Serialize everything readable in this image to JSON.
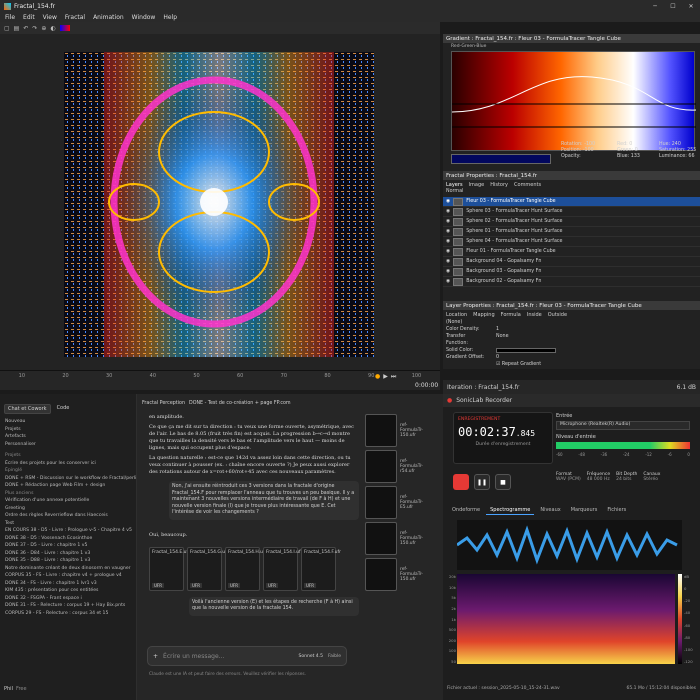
{
  "window": {
    "title": "Fractal_154.fr",
    "minimize": "─",
    "maximize": "☐",
    "close": "✕"
  },
  "menu": [
    "File",
    "Edit",
    "View",
    "Fractal",
    "Animation",
    "Window",
    "Help"
  ],
  "timeline": {
    "ticks": [
      "10",
      "20",
      "30",
      "40",
      "50",
      "60",
      "70",
      "80",
      "90",
      "100"
    ],
    "time": "0:00:00"
  },
  "gradient": {
    "title": "Gradient : Fractal_154.fr : Fleur 03 - FormulaTracer Tangle Cube",
    "preset": "Red-Green-Blue",
    "controls": [
      {
        "l": "Rotation:",
        "v": "-100"
      },
      {
        "l": "Red:",
        "v": "0"
      },
      {
        "l": "Hue:",
        "v": "240"
      },
      {
        "l": "Position:",
        "v": "-100"
      },
      {
        "l": "Green:",
        "v": "0"
      },
      {
        "l": "Saturation:",
        "v": "255"
      },
      {
        "l": "Opacity:",
        "v": ""
      },
      {
        "l": "Blue:",
        "v": "133"
      },
      {
        "l": "Luminance:",
        "v": "66"
      }
    ]
  },
  "fractal_props": {
    "title": "Fractal Properties : Fractal_154.fr",
    "tabs": [
      "Layers",
      "Image",
      "History",
      "Comments"
    ],
    "mode": "Normal",
    "layers": [
      "Fleur 03 - FormulaTracer Tangle Cube",
      "Sphere 03 - FormulaTracer Hunt Surface",
      "Sphere 02 - FormulaTracer Hunt Surface",
      "Sphere 01 - FormulaTracer Hunt Surface",
      "Sphere 04 - FormulaTracer Hunt Surface",
      "Fleur 01 - FormulaTracer Tangle Cube",
      "Background 04 - Gopalsamy Fn",
      "Background 03 - Gopalsamy Fn",
      "Background 02 - Gopalsamy Fn"
    ]
  },
  "layer_props": {
    "title": "Layer Properties : Fractal_154.fr : Fleur 03 - FormulaTracer Tangle Cube",
    "tabs": [
      "Location",
      "Mapping",
      "Formula",
      "Inside",
      "Outside"
    ],
    "none_label": "(None)",
    "color_density": "Color Density:",
    "color_density_value": "1",
    "transfer": "Transfer Function:",
    "transfer_value": "None",
    "solid": "Solid Color:",
    "gradient_offset": "Gradient Offset:",
    "gradient_offset_value": "0",
    "repeat": "Repeat Gradient"
  },
  "iter": {
    "label": "Iteration : Fractal_154.fr",
    "size": "6.1 dB"
  },
  "chat": {
    "tabs": [
      "Chat et Cowork",
      "Code"
    ],
    "nav": [
      "Nouveau",
      "Projets",
      "Artefacts",
      "Personnaliser"
    ],
    "projects_label": "Projets",
    "project_item": "Écrire des projets pour les conserver ici",
    "pinned_label": "Épinglé",
    "pinned": [
      "DONE + RSM - Discussion sur le workflow de Fractal/perlin...",
      "DONE + Rédaction page Web Film + design"
    ],
    "recent_label": "Plus anciens",
    "recent": [
      "Vérification d'une annexe potentielle",
      "Greeting",
      "Ordre des règles Reverrieflow dans Haecceis",
      "Test",
      "EN COURS 38 - D5 - Livre : Prologue v-5 - Chapitre 4 v5",
      "DONE 38 - D5 : Vossenach Ecosinthoe",
      "DONE 37 - D5 - Livre : chapitre 1 v5",
      "DONE 36 - D84 - Livre : chapitre 1 v3",
      "DONE 35 - D88 - Livre : chapitre 1 v3",
      "Notre dominante créant de deux dinosorm en vaugner",
      "CORPUS 35 - FS - Livre : chapitre v4 + prologue v4",
      "DONE 34 - FS - Livre : chapitre 1 lvr1 v3",
      "KIM 435 : présentation pour ces entitées",
      "DONE 32 - FSGPA - Frant espace i",
      "DONE 31 - FS - Relecture : corpus 19 + Hay Bix.pnts",
      "CORPUS 29 - FS - Relecture : corpus 34 et 15"
    ],
    "user": "Phil",
    "plan": "Free",
    "crumb": "Fractal Perception",
    "page_title": "DONE - Test de co-création + page FP.com",
    "p0": "en amplitude.",
    "p1": "Ce que ça me dit sur ta direction : tu veux une forme ouverte, asymétrique, avec de l'air. Le bas de 8.05 (fruit très fin) est acquis. La progression b→c→d montre que tu travailles la densité vers le bas et l'amplitude vers le haut — moins de lignes, mais qui occupent plus d'espace.",
    "p2": "La question naturelle : est-ce que 142d va assez loin dans cette direction, ou tu veux continuer à pousser (ex. : chaîne encore ouverte ?) Je peux aussi explorer des rotations autour de x=rot+60/rot+45 avec ces nouveaux paramètres.",
    "user_msg": "Non, j'ai ensuite réintroduit ces 3 versions dans la fractale d'origine Fractal_154.F pour remplacer l'anneau que tu trouves un peu basique. Il y a maintenant 3 nouvelles versions intermédiaire de travail (de F à H) et une nouvelle version finale (I) que je trouve plus intéressante que E. Cet l'intérêse de voir les changements ?",
    "reply": "Oui, beaucoup.",
    "files": [
      "Fractal_154.E.ufr",
      "Fractal_154.G.ufr",
      "Fractal_154.H.ufr",
      "Fractal_154.I.ufr",
      "Fractal_154.F.ufr"
    ],
    "file_tag": "UFR",
    "p3": "Voilà l'ancienne version (E) et les étapes de recherche (F à H) ainsi que la nouvelle version de la fractale 154.",
    "input_placeholder": "Écrire un message...",
    "model": "Sonnet 4.5",
    "model_mode": "Faible",
    "footer": "Claude est une IA et peut faire des erreurs. Veuillez vérifier les réponses.",
    "attachments": [
      "ref-FormulaTr-150.ufr",
      "ref-FormulaTr-r54.ufr",
      "ref-FormulaTr-E5.ufr",
      "ref-FormulaTr-150.ufr",
      "ref-FormulaTr-150.ufr"
    ]
  },
  "rec": {
    "title": "SonicLab Recorder",
    "status": "ENREGISTREMENT",
    "time_main": "00:02:37",
    "time_ms": ".845",
    "time_label": "Durée d'enregistrement",
    "input_label": "Entrée",
    "device": "Microphone (Realtek(R) Audio)",
    "level_label": "Niveau d'entrée",
    "scale": [
      "-60",
      "-48",
      "-36",
      "-24",
      "-12",
      "-6",
      "0"
    ],
    "fmt": [
      {
        "l": "Format",
        "v": "WAV (PCM)"
      },
      {
        "l": "Fréquence",
        "v": "48 000 Hz"
      },
      {
        "l": "Bit Depth",
        "v": "24 bits"
      },
      {
        "l": "Canaux",
        "v": "Stéréo"
      }
    ],
    "tabs": [
      "Ondeforme",
      "Spectrogramme",
      "Niveaux",
      "Marqueurs",
      "Fichiers"
    ],
    "freq": [
      "20k",
      "10k",
      "5k",
      "2k",
      "1k",
      "500",
      "200",
      "100",
      "50"
    ],
    "db": [
      "dB",
      "0",
      "-20",
      "-40",
      "-60",
      "-80",
      "-100",
      "-120"
    ],
    "footer": "Fichier actuel : session_2025-05-10_15-24-31.wav",
    "footer_right": "65.1 Mo / 15:12:04 disponibles"
  },
  "colors": {
    "accent": "#2f6fd8",
    "record": "#e53935"
  }
}
